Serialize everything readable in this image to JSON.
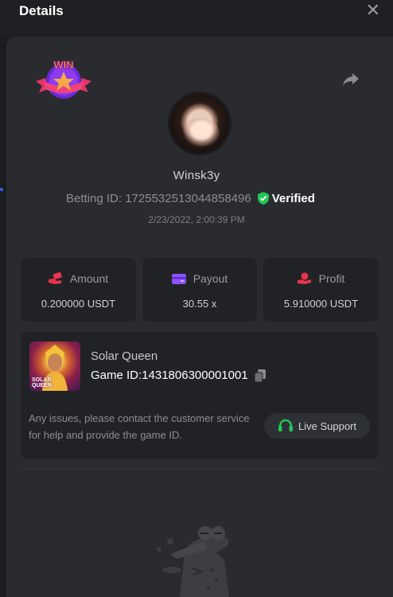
{
  "header": {
    "title": "Details"
  },
  "player": {
    "username": "Winsk3y",
    "betting_id_label": "Betting ID: 1725532513044858496",
    "verified_label": "Verified",
    "timestamp": "2/23/2022, 2:00:39 PM"
  },
  "badge": {
    "text": "WIN"
  },
  "stats": [
    {
      "label": "Amount",
      "value": "0.200000 USDT",
      "icon": "money-hand-icon"
    },
    {
      "label": "Payout",
      "value": "30.55 x",
      "icon": "wallet-icon"
    },
    {
      "label": "Profit",
      "value": "5.910000 USDT",
      "icon": "coin-hand-icon"
    }
  ],
  "game": {
    "name": "Solar Queen",
    "id_label": "Game ID:1431806300001001",
    "thumb_text_1": "SOLAR",
    "thumb_text_2": "QUEEN"
  },
  "notice": "Any issues, please contact the customer service for help and provide the game ID.",
  "support": {
    "label": "Live Support"
  },
  "colors": {
    "accent_green": "#20c655",
    "profit_red": "#e8344e",
    "payout_purple": "#8c52ff",
    "panel": "#292b2e",
    "card": "#202225"
  }
}
